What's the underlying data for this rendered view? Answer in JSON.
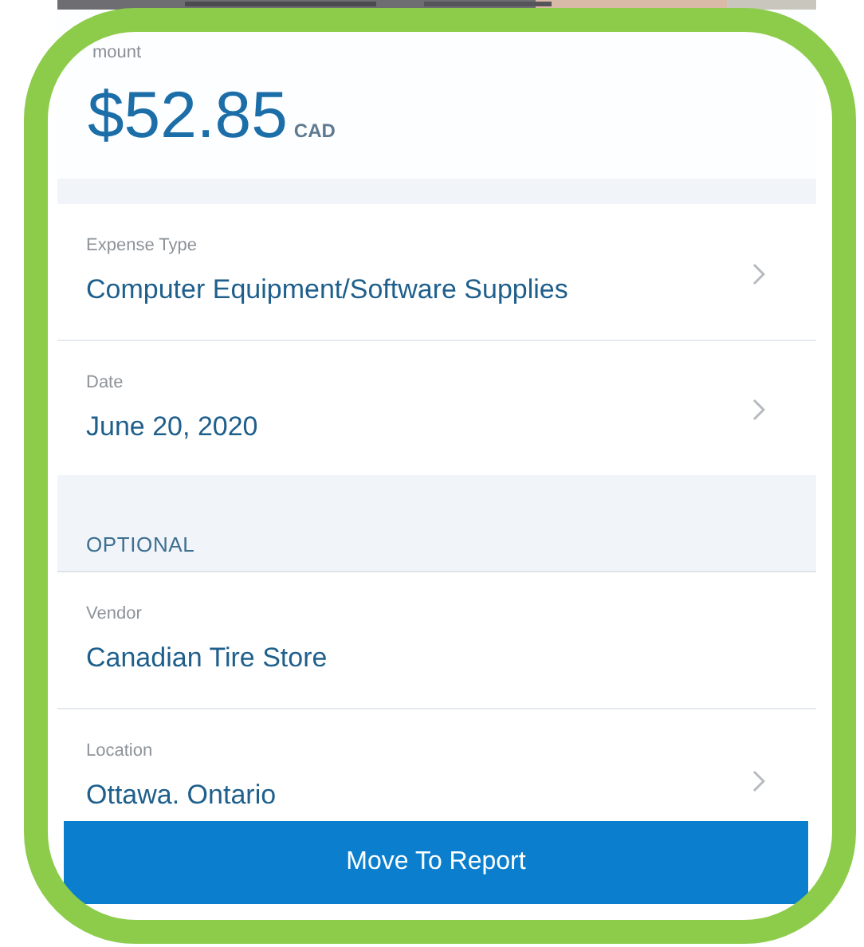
{
  "amount": {
    "label": "mount",
    "value": "$52.85",
    "currency": "CAD"
  },
  "sections": [
    {
      "kind": "fields",
      "fields": [
        {
          "label": "Expense Type",
          "value": "Computer Equipment/Software Supplies",
          "chevron": true
        },
        {
          "label": "Date",
          "value": "June 20, 2020",
          "chevron": true
        }
      ]
    },
    {
      "kind": "header",
      "title": "OPTIONAL"
    },
    {
      "kind": "fields",
      "fields": [
        {
          "label": "Vendor",
          "value": "Canadian Tire Store",
          "chevron": false
        },
        {
          "label": "Location",
          "value": "Ottawa. Ontario",
          "chevron": true
        }
      ]
    }
  ],
  "button": "Move To Report"
}
